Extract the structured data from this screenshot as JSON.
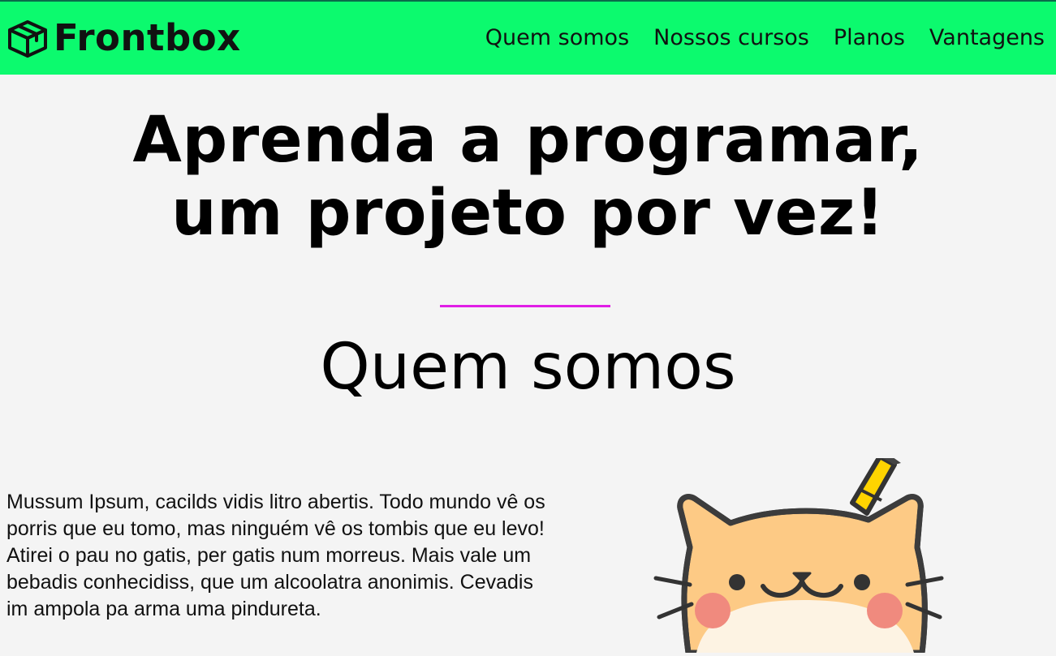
{
  "header": {
    "brand": "Frontbox",
    "logo_icon": "box-icon",
    "nav": [
      {
        "label": "Quem somos"
      },
      {
        "label": "Nossos cursos"
      },
      {
        "label": "Planos"
      },
      {
        "label": "Vantagens"
      }
    ],
    "background_color": "#0cfa6e"
  },
  "hero": {
    "title_line1": "Aprenda a programar,",
    "title_line2": "um projeto por vez!"
  },
  "about": {
    "divider_color": "#e01ee6",
    "title": "Quem somos",
    "text": "Mussum Ipsum, cacilds vidis litro abertis. Todo mundo vê os porris que eu tomo, mas ninguém vê os tombis que eu levo! Atirei o pau no gatis, per gatis num morreus. Mais vale um bebadis conhecidiss, que um alcoolatra anonimis. Cevadis im ampola pa arma uma pindureta.",
    "illustration": "cat-with-pencil-illustration"
  }
}
